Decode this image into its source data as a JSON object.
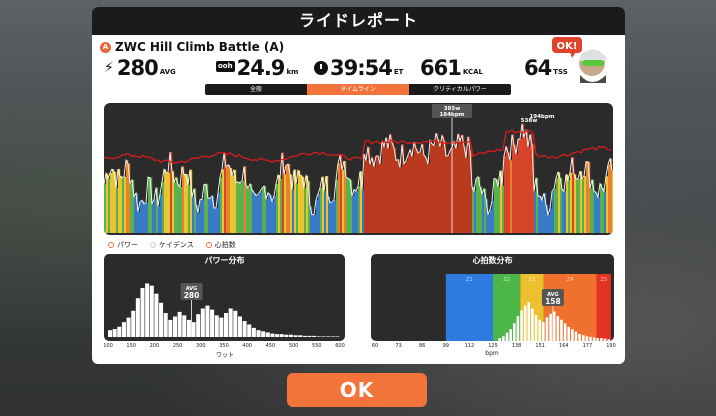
{
  "header": {
    "title": "ライドレポート"
  },
  "ride": {
    "badge": "A",
    "name": "ZWC Hill Climb Battle (A)"
  },
  "stats": {
    "power": {
      "value": "280",
      "unit": "AVG"
    },
    "distance": {
      "badge": "ooh",
      "value": "24.9",
      "unit": "km"
    },
    "time": {
      "value": "39:54",
      "unit": "ET"
    },
    "energy": {
      "value": "661",
      "unit": "KCAL"
    },
    "tss": {
      "value": "64",
      "unit": "TSS"
    }
  },
  "avatar": {
    "bubble": "OK!"
  },
  "tabs": [
    {
      "label": "全般",
      "active": false
    },
    {
      "label": "タイムライン",
      "active": true
    },
    {
      "label": "クリティカルパワー",
      "active": false
    }
  ],
  "chart_data": [
    {
      "type": "timeline",
      "title": "",
      "series": [
        {
          "name": "パワー",
          "color": "#ffffff"
        },
        {
          "name": "心拍数",
          "color": "#d71c1c"
        }
      ],
      "annotations": [
        "385w",
        "184bpm",
        "538w",
        "194bpm"
      ],
      "zone_colors": [
        "#3a7bc8",
        "#5cb14f",
        "#e8c531",
        "#e8822d",
        "#d6442a",
        "#b33020"
      ]
    },
    {
      "type": "bar",
      "title": "パワー分布",
      "xlabel": "ワット",
      "x_ticks": [
        "100",
        "150",
        "200",
        "250",
        "300",
        "350",
        "400",
        "450",
        "500",
        "550",
        "600"
      ],
      "xlim": [
        100,
        600
      ],
      "bin_width": 10,
      "values": [
        0.12,
        0.14,
        0.18,
        0.26,
        0.34,
        0.46,
        0.68,
        0.86,
        0.94,
        0.9,
        0.76,
        0.6,
        0.42,
        0.3,
        0.36,
        0.44,
        0.38,
        0.3,
        0.26,
        0.4,
        0.5,
        0.55,
        0.48,
        0.38,
        0.34,
        0.42,
        0.5,
        0.46,
        0.36,
        0.28,
        0.22,
        0.16,
        0.12,
        0.1,
        0.08,
        0.06,
        0.05,
        0.05,
        0.04,
        0.04,
        0.03,
        0.03,
        0.02,
        0.02,
        0.02,
        0.01,
        0.01,
        0.01,
        0.01,
        0.01
      ],
      "avg_label": "AVG",
      "avg_value": 280
    },
    {
      "type": "bar",
      "title": "心拍数分布",
      "xlabel": "bpm",
      "x_ticks": [
        "60",
        "73",
        "86",
        "99",
        "112",
        "125",
        "138",
        "151",
        "164",
        "177",
        "190"
      ],
      "xlim": [
        60,
        190
      ],
      "zones": [
        {
          "from": 99,
          "to": 125,
          "color": "#2e7be0",
          "label": "Z1"
        },
        {
          "from": 125,
          "to": 140,
          "color": "#4cb648",
          "label": "Z2"
        },
        {
          "from": 140,
          "to": 153,
          "color": "#ecc02e",
          "label": "Z3"
        },
        {
          "from": 153,
          "to": 182,
          "color": "#f0702e",
          "label": "Z4"
        },
        {
          "from": 182,
          "to": 190,
          "color": "#e43222",
          "label": "Z5"
        }
      ],
      "bars": [
        [
          128,
          0.05
        ],
        [
          130,
          0.08
        ],
        [
          132,
          0.14
        ],
        [
          134,
          0.2
        ],
        [
          136,
          0.3
        ],
        [
          138,
          0.42
        ],
        [
          140,
          0.52
        ],
        [
          142,
          0.6
        ],
        [
          144,
          0.66
        ],
        [
          146,
          0.55
        ],
        [
          148,
          0.44
        ],
        [
          150,
          0.36
        ],
        [
          152,
          0.32
        ],
        [
          154,
          0.4
        ],
        [
          156,
          0.46
        ],
        [
          158,
          0.5
        ],
        [
          160,
          0.42
        ],
        [
          162,
          0.36
        ],
        [
          164,
          0.3
        ],
        [
          166,
          0.24
        ],
        [
          168,
          0.2
        ],
        [
          170,
          0.16
        ],
        [
          172,
          0.12
        ],
        [
          174,
          0.1
        ],
        [
          176,
          0.08
        ],
        [
          178,
          0.07
        ],
        [
          180,
          0.06
        ],
        [
          182,
          0.05
        ],
        [
          184,
          0.05
        ],
        [
          186,
          0.04
        ],
        [
          188,
          0.03
        ]
      ],
      "avg_label": "AVG",
      "avg_value": 158
    }
  ],
  "legend": [
    {
      "label": "パワー"
    },
    {
      "label": "ケイデンス"
    },
    {
      "label": "心拍数"
    }
  ],
  "ok_button": {
    "label": "OK"
  }
}
